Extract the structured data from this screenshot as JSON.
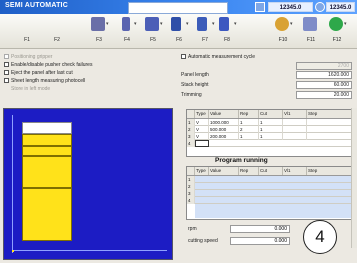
{
  "window": {
    "title": "SEMI AUTOMATIC",
    "value_1": "12345.0",
    "value_2": "12345.0"
  },
  "toolbar": {
    "keys": [
      {
        "label": "F1",
        "icon": "blank-icon"
      },
      {
        "label": "F2",
        "icon": "blank-icon"
      },
      {
        "label": "F3",
        "icon": "tools-icon"
      },
      {
        "label": "F4",
        "icon": "sheet-icon"
      },
      {
        "label": "F5",
        "icon": "saw-icon"
      },
      {
        "label": "F6",
        "icon": "list-icon"
      },
      {
        "label": "F7",
        "icon": "sheet2-icon"
      },
      {
        "label": "F8",
        "icon": "stack-icon"
      },
      {
        "label": "F10",
        "icon": "person-icon"
      },
      {
        "label": "F11",
        "icon": "return-icon"
      },
      {
        "label": "F12",
        "icon": "start-icon"
      }
    ]
  },
  "options": {
    "items": [
      {
        "label": "Positioning gripper",
        "checked": false,
        "disabled": true
      },
      {
        "label": "Enable/disable pusher check failures",
        "checked": false,
        "disabled": false
      },
      {
        "label": "Eject the panel after last cut",
        "checked": false,
        "disabled": false
      },
      {
        "label": "Sheet length measuring photocell",
        "checked": false,
        "disabled": false
      },
      {
        "label": "Store in left mode",
        "checked": false,
        "disabled": true
      }
    ]
  },
  "params": {
    "auto_cycle_label": "Automatic measurement cycle",
    "fields": [
      {
        "label": "",
        "value": "2700",
        "disabled": true
      },
      {
        "label": "Panel length",
        "value": "1620.000",
        "disabled": false
      },
      {
        "label": "Stack height",
        "value": "60.000",
        "disabled": false
      },
      {
        "label": "Trimming",
        "value": "20.000",
        "disabled": false
      }
    ]
  },
  "cut_table": {
    "headers": [
      "",
      "Type",
      "Value",
      "Rep",
      "Cut",
      "Vl1",
      "Step"
    ],
    "rows": [
      [
        "1",
        "V",
        "1000.000",
        "1",
        "1",
        "",
        ""
      ],
      [
        "2",
        "V",
        "500.000",
        "2",
        "1",
        "",
        ""
      ],
      [
        "3",
        "V",
        "200.000",
        "1",
        "1",
        "",
        ""
      ],
      [
        "4",
        "",
        "",
        "",
        "",
        "",
        ""
      ]
    ]
  },
  "running": {
    "title": "Program running",
    "headers": [
      "",
      "Type",
      "Value",
      "Rep",
      "Cut",
      "Vl1",
      "Step"
    ],
    "rows": [
      [
        "1"
      ],
      [
        "2"
      ],
      [
        "3"
      ],
      [
        "4"
      ]
    ]
  },
  "bottom": {
    "rpm_label": "rpm",
    "rpm_value": "0.000",
    "speed_label": "cutting speed",
    "speed_value": "0.000"
  },
  "badge": "4",
  "colors": {
    "title_bar": "#2a6fe0",
    "preview_bg": "#1c1cc4",
    "panel_fill": "#ffe21a"
  }
}
